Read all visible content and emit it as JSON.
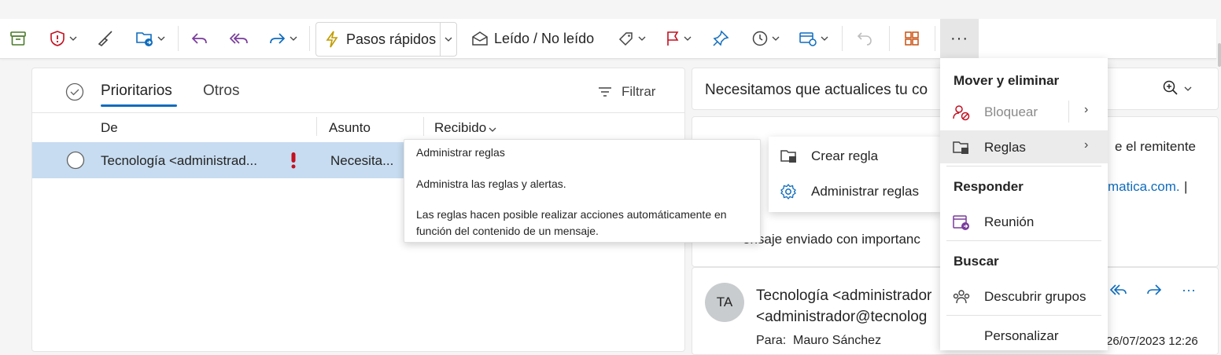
{
  "toolbar": {
    "quick_steps_label": "Pasos rápidos",
    "read_unread_label": "Leído / No leído",
    "more_label": "···"
  },
  "list": {
    "tabs": [
      {
        "label": "Prioritarios",
        "selected": true
      },
      {
        "label": "Otros",
        "selected": false
      }
    ],
    "filter_label": "Filtrar",
    "columns": {
      "from": "De",
      "subject": "Asunto",
      "received": "Recibido"
    },
    "rows": [
      {
        "from": "Tecnología <administrad...",
        "subject": "Necesita...",
        "important": true,
        "selected": true
      }
    ]
  },
  "reading": {
    "subject": "Necesitamos que actualices tu co",
    "line1_right": "e el remitente",
    "line_link": "matica.com.",
    "pipe": "|",
    "importance_note": "ensaje enviado con importanc",
    "sender_name": "Tecnología <administrador",
    "sender_email": "<administrador@tecnolog",
    "to_label": "Para:",
    "to_value": "Mauro Sánchez",
    "date": "26/07/2023 12:26",
    "avatar_initials": "TA"
  },
  "tooltip": {
    "title": "Administrar reglas",
    "line1": "Administra las reglas y alertas.",
    "line2": "Las reglas hacen posible realizar acciones automáticamente en función del contenido de un mensaje."
  },
  "rules_submenu": {
    "items": [
      {
        "label": "Crear regla"
      },
      {
        "label": "Administrar reglas"
      }
    ]
  },
  "more_menu": {
    "sections": [
      {
        "header": "Mover y eliminar",
        "items": [
          {
            "label": "Bloquear"
          },
          {
            "label": "Reglas"
          }
        ]
      },
      {
        "header": "Responder",
        "items": [
          {
            "label": "Reunión"
          }
        ]
      },
      {
        "header": "Buscar",
        "items": [
          {
            "label": "Descubrir grupos"
          }
        ]
      }
    ],
    "customize_label": "Personalizar"
  },
  "colors": {
    "accent": "#0f6cbd",
    "selected_row": "#c7dcf0",
    "important": "#c50f1f",
    "icon_blue": "#0f6cbd",
    "icon_purple": "#7a3c9c"
  }
}
